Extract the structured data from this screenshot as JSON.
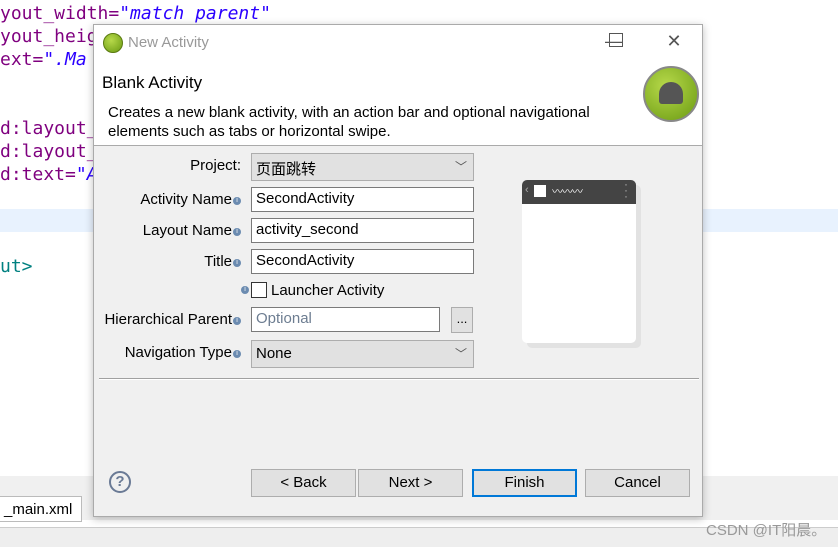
{
  "editor": {
    "lines": [
      {
        "a": "yout_width=",
        "s": "\"match parent\""
      },
      {
        "a": "yout_heig",
        "s": ""
      },
      {
        "a": "ext=",
        "s": "\".Ma"
      },
      {
        "a": "d:layout_",
        "s": ""
      },
      {
        "a": "d:layout_",
        "s": ""
      },
      {
        "a": "d:text=",
        "s": "\"A"
      },
      {
        "a": "ut>",
        "s": ""
      }
    ],
    "tab_label": "_main.xml"
  },
  "dialog": {
    "title": "New Activity",
    "heading": "Blank Activity",
    "description": "Creates a new blank activity, with an action bar and optional navigational elements such as tabs or horizontal swipe.",
    "fields": {
      "project": {
        "label": "Project:",
        "value": "页面跳转"
      },
      "activity_name": {
        "label": "Activity Name",
        "value": "SecondActivity"
      },
      "layout_name": {
        "label": "Layout Name",
        "value": "activity_second"
      },
      "title": {
        "label": "Title",
        "value": "SecondActivity"
      },
      "launcher": {
        "label": "Launcher Activity",
        "checked": false
      },
      "hierarchical_parent": {
        "label": "Hierarchical Parent",
        "value": "",
        "placeholder": "Optional",
        "browse": "..."
      },
      "navigation_type": {
        "label": "Navigation Type",
        "value": "None"
      }
    },
    "buttons": {
      "back": "< Back",
      "next": "Next >",
      "finish": "Finish",
      "cancel": "Cancel"
    },
    "accent": "#0078d7"
  },
  "watermark": "CSDN @IT阳晨。"
}
